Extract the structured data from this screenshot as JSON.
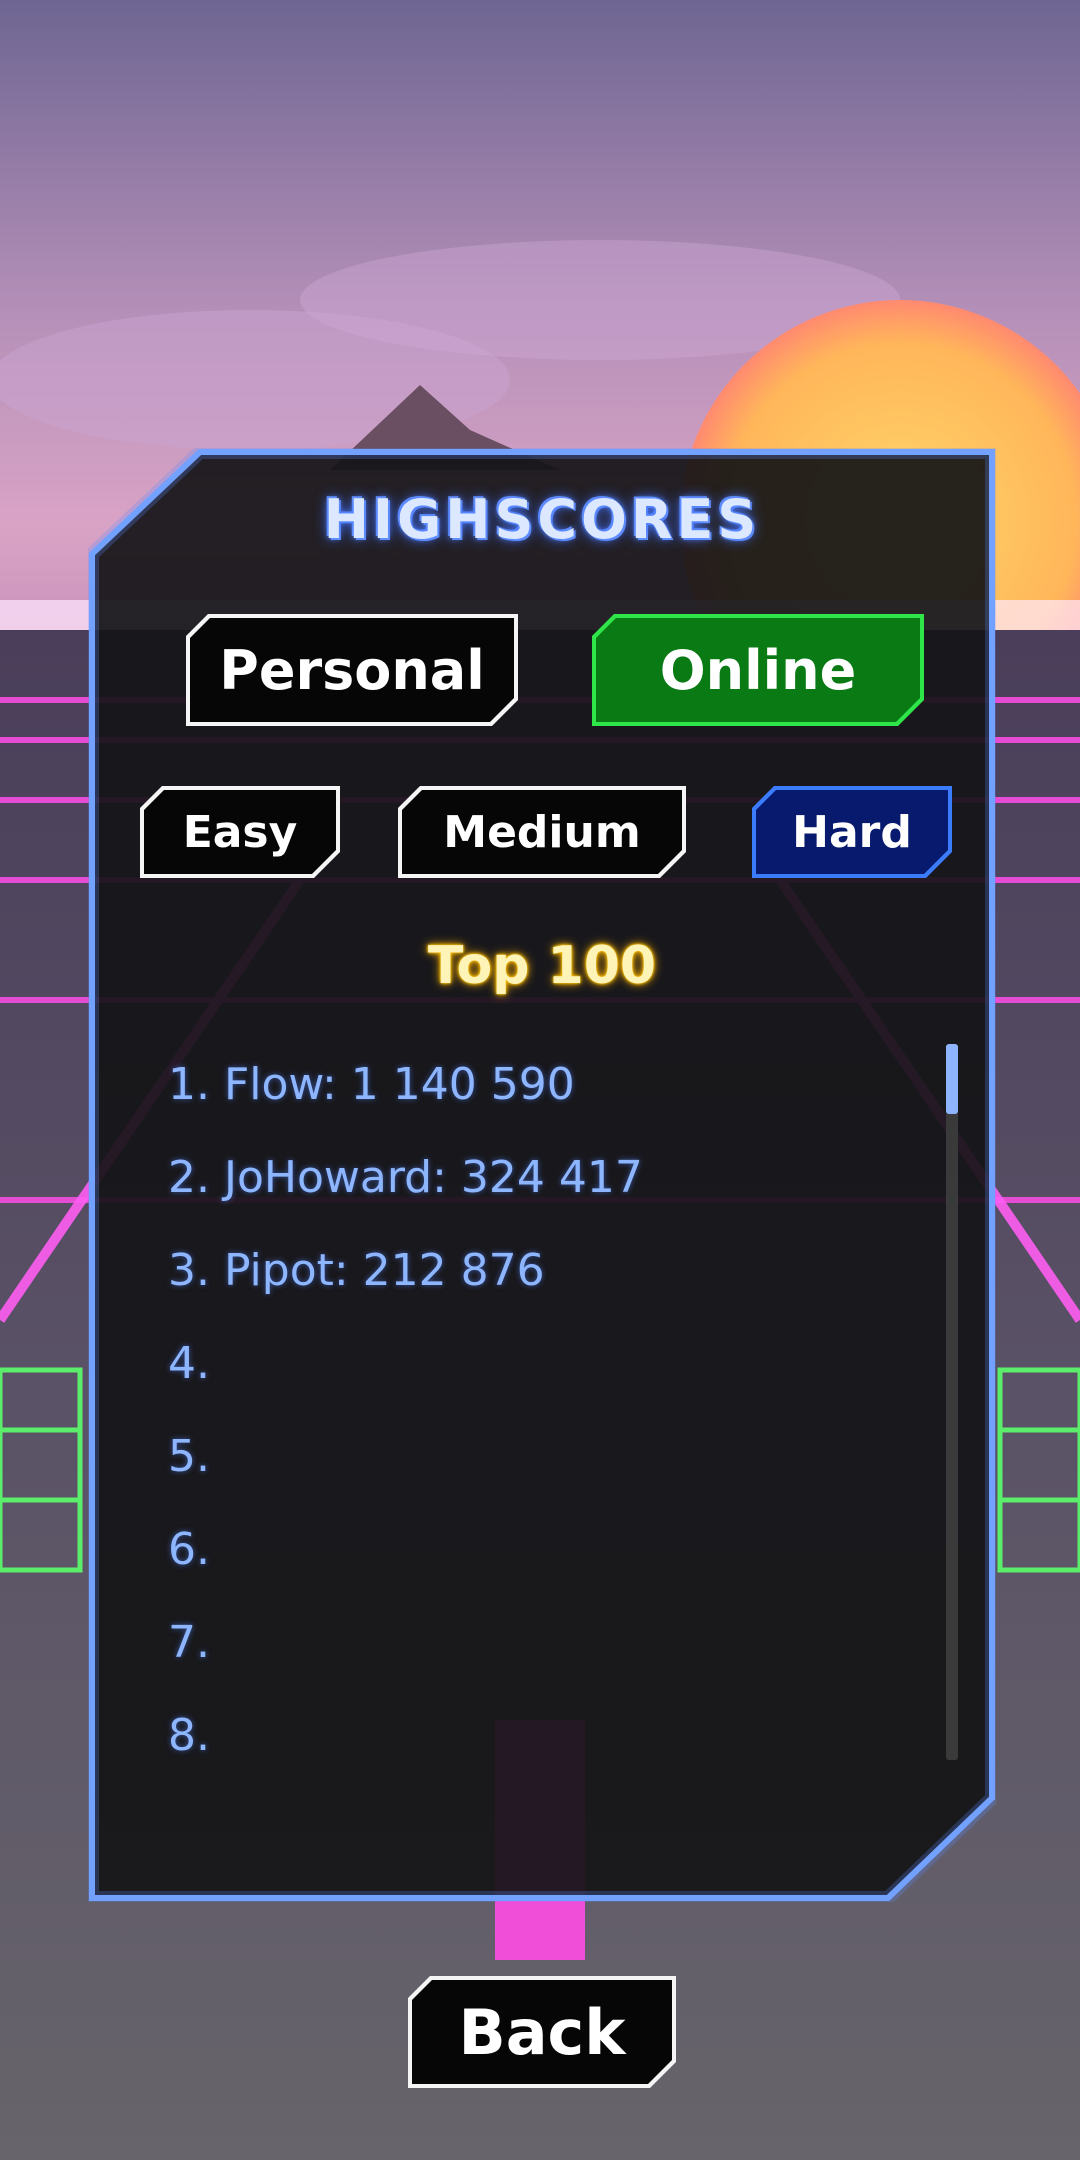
{
  "screen": {
    "title": "HIGHSCORES",
    "mode_tabs": [
      {
        "label": "Personal",
        "selected": false
      },
      {
        "label": "Online",
        "selected": true
      }
    ],
    "difficulty_tabs": [
      {
        "label": "Easy",
        "selected": false
      },
      {
        "label": "Medium",
        "selected": false
      },
      {
        "label": "Hard",
        "selected": true
      }
    ],
    "section_label": "Top 100",
    "scores": [
      "1. Flow: 1 140 590",
      "2. JoHoward: 324 417",
      "3. Pipot: 212 876",
      "4.",
      "5.",
      "6.",
      "7.",
      "8."
    ],
    "back_label": "Back"
  },
  "colors": {
    "panel_border": "#7aa8ff",
    "selected_mode": "#0a7a14",
    "selected_difficulty": "#071a6e",
    "list_text": "#8db6ff",
    "title_glow": "#5b8cff"
  }
}
